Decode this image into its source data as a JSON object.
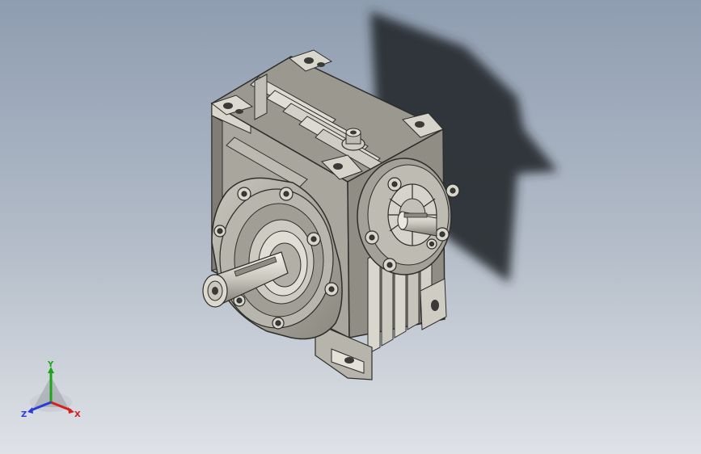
{
  "viewport": {
    "model_name": "",
    "background_top": "#8f9db1",
    "background_bottom": "#dfe2e7"
  },
  "triad": {
    "x_label": "X",
    "y_label": "Y",
    "z_label": "Z",
    "x_color": "#d22020",
    "y_color": "#1aa51a",
    "z_color": "#2a3ad8"
  }
}
